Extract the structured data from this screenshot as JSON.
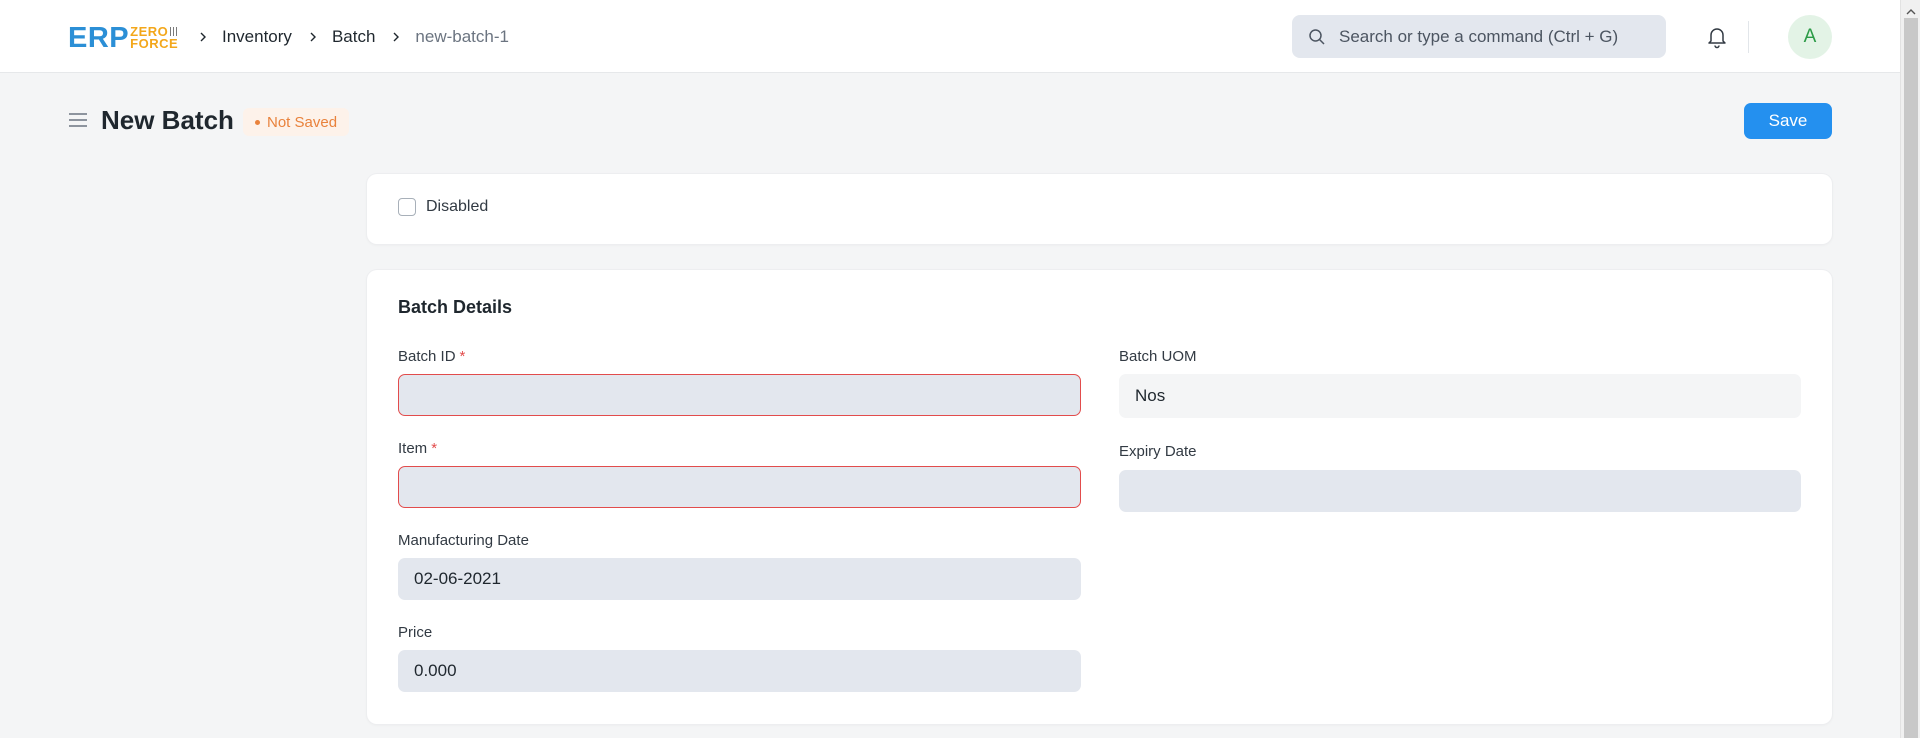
{
  "app": {
    "logo_main": "ERP",
    "logo_sub_top": "ZERO",
    "logo_sub_bottom": "FORCE"
  },
  "breadcrumbs": [
    "Inventory",
    "Batch",
    "new-batch-1"
  ],
  "search": {
    "placeholder": "Search or type a command (Ctrl + G)"
  },
  "user": {
    "avatar_initial": "A"
  },
  "page": {
    "title": "New Batch",
    "status": "Not Saved",
    "save_label": "Save"
  },
  "form": {
    "disabled_label": "Disabled",
    "section_title": "Batch Details",
    "fields": {
      "batch_id": {
        "label": "Batch ID",
        "required": "*",
        "value": ""
      },
      "item": {
        "label": "Item",
        "required": "*",
        "value": ""
      },
      "manufacturing_date": {
        "label": "Manufacturing Date",
        "value": "02-06-2021"
      },
      "price": {
        "label": "Price",
        "value": "0.000"
      },
      "batch_uom": {
        "label": "Batch UOM",
        "value": "Nos"
      },
      "expiry_date": {
        "label": "Expiry Date",
        "value": ""
      }
    }
  },
  "colors": {
    "accent": "#2490ef",
    "status_warning": "#e9823c",
    "error": "#e24c4c",
    "logo_blue": "#2b8fd6",
    "logo_orange": "#f3a71b"
  },
  "icons": [
    "chevron-right-icon",
    "search-icon",
    "bell-icon",
    "hamburger-menu-icon",
    "scroll-up-icon"
  ]
}
